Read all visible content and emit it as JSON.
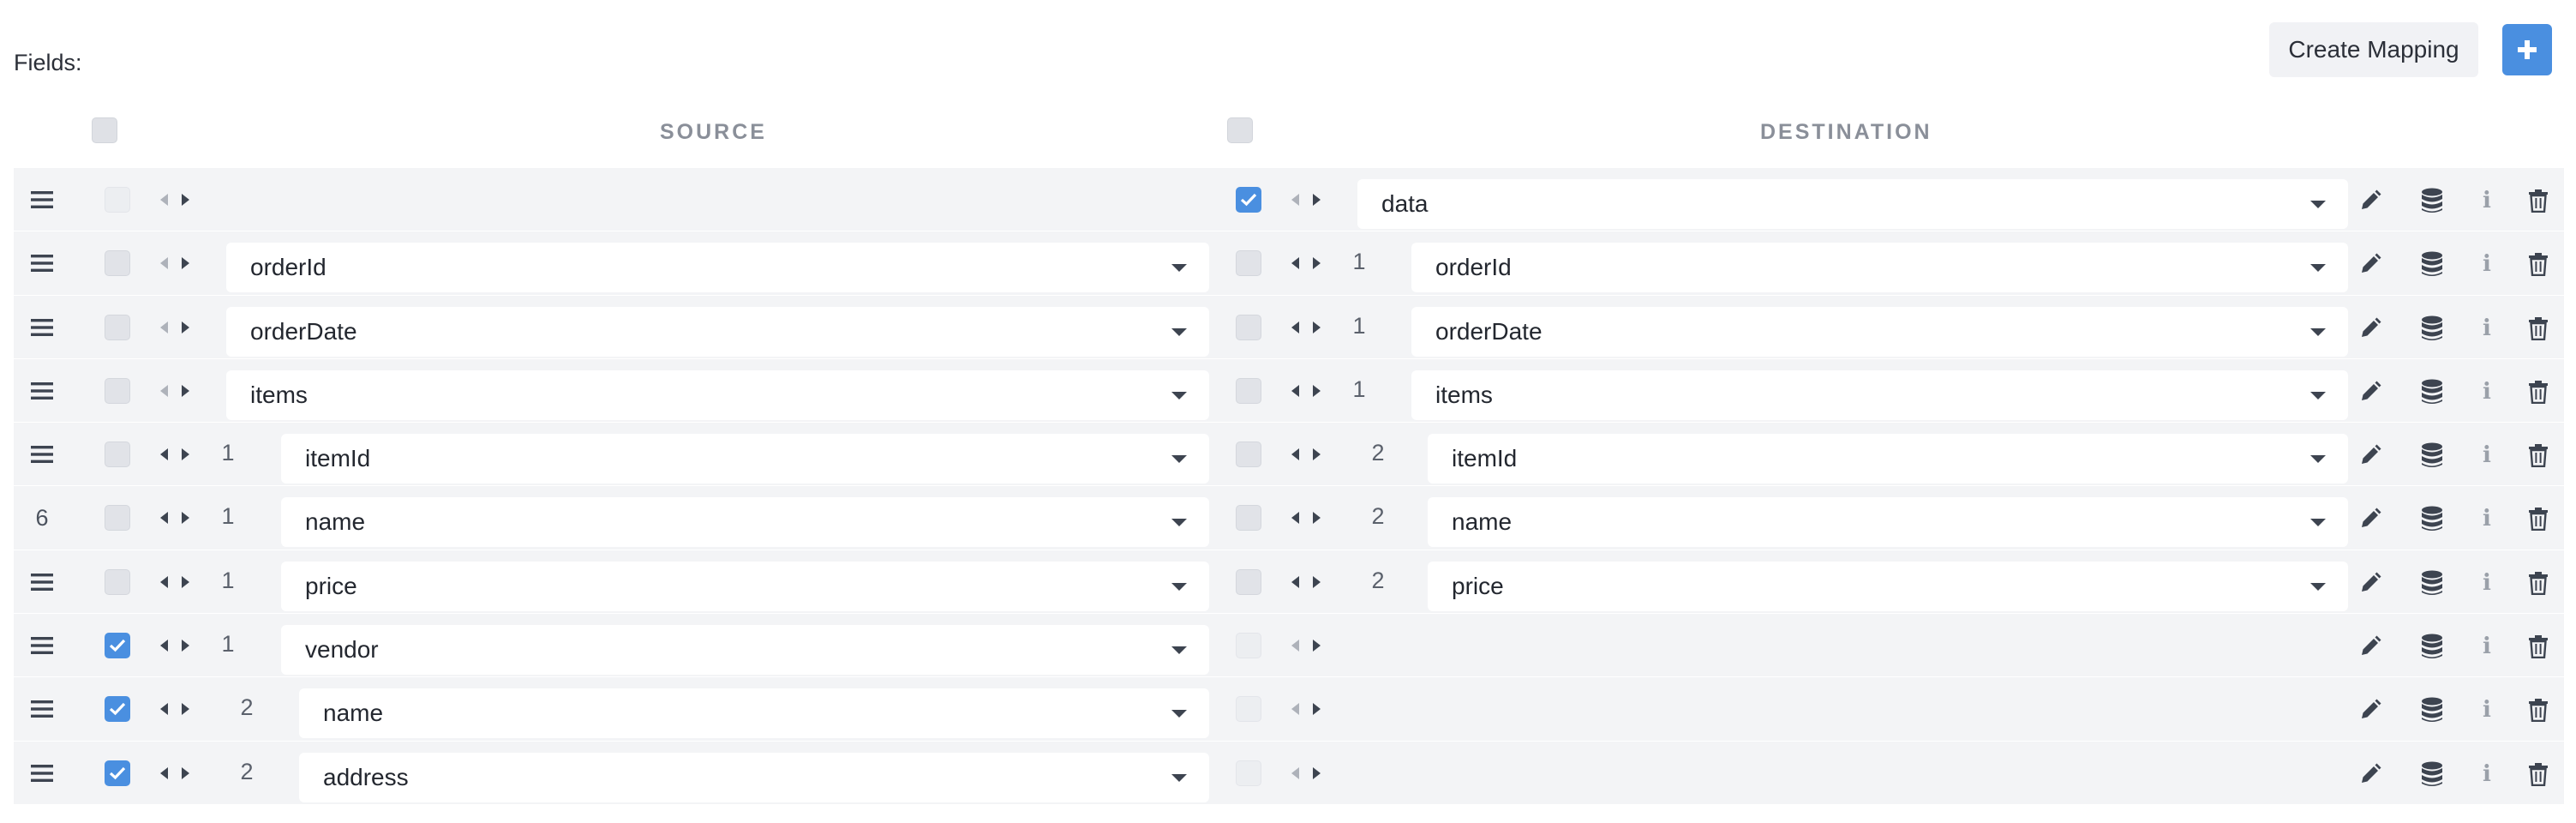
{
  "header": {
    "fields_label": "Fields:",
    "create_mapping_label": "Create Mapping",
    "add_label": "+",
    "source_label": "SOURCE",
    "destination_label": "DESTINATION"
  },
  "colors": {
    "accent": "#4a8fe0",
    "row_bg": "#f3f4f6",
    "text": "#2d3340"
  },
  "rows": [
    {
      "grip": "drag-handle",
      "src_checked": false,
      "src_faint": true,
      "src_level": "",
      "src_field": "",
      "src_indent": 0,
      "dst_checked": true,
      "dst_level": "",
      "dst_field": "data",
      "dst_indent": 0
    },
    {
      "grip": "drag-handle",
      "src_checked": false,
      "src_level": "",
      "src_field": "orderId",
      "src_indent": 0,
      "dst_checked": false,
      "dst_level": "1",
      "dst_field": "orderId",
      "dst_indent": 1
    },
    {
      "grip": "drag-handle",
      "src_checked": false,
      "src_level": "",
      "src_field": "orderDate",
      "src_indent": 0,
      "dst_checked": false,
      "dst_level": "1",
      "dst_field": "orderDate",
      "dst_indent": 1
    },
    {
      "grip": "drag-handle",
      "src_checked": false,
      "src_level": "",
      "src_field": "items",
      "src_indent": 0,
      "dst_checked": false,
      "dst_level": "1",
      "dst_field": "items",
      "dst_indent": 1
    },
    {
      "grip": "drag-handle",
      "src_checked": false,
      "src_level": "1",
      "src_field": "itemId",
      "src_indent": 1,
      "dst_checked": false,
      "dst_level": "2",
      "dst_field": "itemId",
      "dst_indent": 2
    },
    {
      "grip": "6",
      "src_checked": false,
      "src_level": "1",
      "src_field": "name",
      "src_indent": 1,
      "dst_checked": false,
      "dst_level": "2",
      "dst_field": "name",
      "dst_indent": 2
    },
    {
      "grip": "drag-handle",
      "src_checked": false,
      "src_level": "1",
      "src_field": "price",
      "src_indent": 1,
      "dst_checked": false,
      "dst_level": "2",
      "dst_field": "price",
      "dst_indent": 2
    },
    {
      "grip": "drag-handle",
      "src_checked": true,
      "src_level": "1",
      "src_field": "vendor",
      "src_indent": 1,
      "dst_checked": false,
      "dst_faint": true,
      "dst_level": "",
      "dst_field": "",
      "dst_indent": 0
    },
    {
      "grip": "drag-handle",
      "src_checked": true,
      "src_level": "2",
      "src_field": "name",
      "src_indent": 2,
      "dst_checked": false,
      "dst_faint": true,
      "dst_level": "",
      "dst_field": "",
      "dst_indent": 0
    },
    {
      "grip": "drag-handle",
      "src_checked": true,
      "src_level": "2",
      "src_field": "address",
      "src_indent": 2,
      "dst_checked": false,
      "dst_faint": true,
      "dst_level": "",
      "dst_field": "",
      "dst_indent": 0
    }
  ]
}
